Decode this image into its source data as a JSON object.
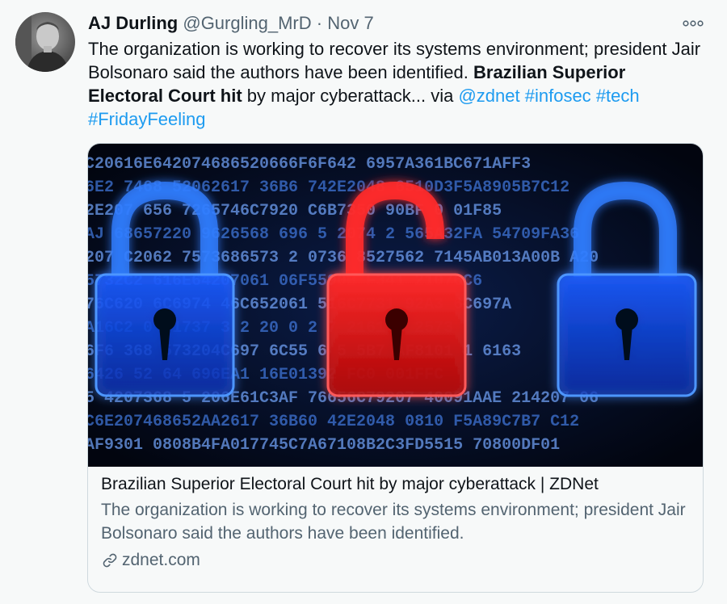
{
  "tweet": {
    "author_name": "AJ Durling",
    "handle": "@Gurgling_MrD",
    "separator": "·",
    "date": "Nov 7",
    "text_plain_1": "The organization is working to recover its systems environment; president Jair Bolsonaro said the authors have been identified. ",
    "text_bold": "Brazilian Superior Electoral Court hit",
    "text_plain_2": " by major cyberattack... via ",
    "mention": "@zdnet",
    "hashtag_1": "#infosec",
    "hashtag_2": "#tech",
    "hashtag_3": "#FridayFeeling"
  },
  "card": {
    "title": "Brazilian Superior Electoral Court hit by major cyberattack | ZDNet",
    "description": "The organization is working to recover its systems environment; president Jair Bolsonaro said the authors have been identified.",
    "domain": "zdnet.com",
    "image_hex_rows": [
      "C20616E642074686520666F6F642 6957A361BC671AFF3",
      "6E2 7468 52062617 36B6 742E2048 6510D3F5A8905B7C12",
      "2E207 656 7265746C7920 C6B7350 90BF 0 01F85",
      "AJ 68657220 9626568 696 5 2074 2 565A32FA 54709FA36",
      "207 C2062 7573686573 2 0736 8527562 7145AB013A00B A20",
      "5732C2 616E64207061 06F5590B F341 21076C6",
      "76C620 6C6974 46C652061 516C7731 92A3 6C697A",
      "A16C2 0 61737 3 2 20 0 2 7 2161 A 2573",
      "6F6 368 573204C697 6C55 6 5 5B7 AF8101 1 6163",
      "6426 52 64 696EA1 16E01392 FC0 001FFC",
      "5 4207368 5 206E61C3AF 76656C79207 40091AAE 214207 06",
      "C6E207468652AA2617 36B60 42E2048 0810 F5A89C7B7 C12",
      "AF9301 0808B4FA017745C7A67108B2C3FD5515 70800DF01"
    ]
  },
  "colors": {
    "accent": "#1d9bf0",
    "secondary_text": "#536471",
    "background": "#f7f9f9",
    "border": "#cfd9de",
    "lock_blue": "#1e7bff",
    "lock_red": "#ff2020"
  },
  "icons": {
    "more": "more-horizontal-icon",
    "link": "link-icon",
    "avatar": "avatar"
  }
}
